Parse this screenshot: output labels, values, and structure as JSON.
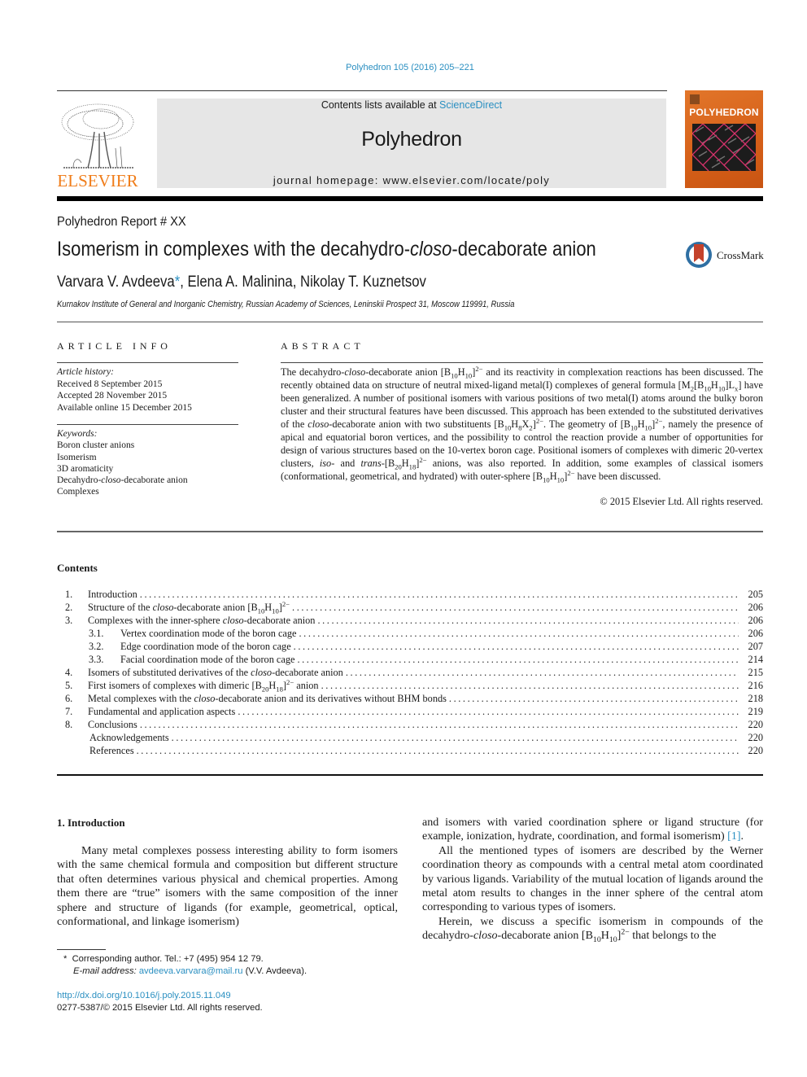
{
  "header": {
    "journal_ref": "Polyhedron 105 (2016) 205–221",
    "contents_prefix": "Contents lists available at ",
    "contents_link": "ScienceDirect",
    "journal_title": "Polyhedron",
    "homepage": "journal homepage: www.elsevier.com/locate/poly",
    "publisher_logo_text": "ELSEVIER",
    "cover_title": "POLYHEDRON",
    "brand_color": "#f07d1a",
    "link_color": "#2a8fc1"
  },
  "article": {
    "report_label": "Polyhedron Report # XX",
    "title_pre": "Isomerism in complexes with the decahydro-",
    "title_italic": "closo",
    "title_post": "-decaborate anion",
    "crossmark_label": "CrossMark",
    "author1": "Varvara V. Avdeeva",
    "author1_mark": "*",
    "authors_rest": ", Elena A. Malinina, Nikolay T. Kuznetsov",
    "affiliation": "Kurnakov Institute of General and Inorganic Chemistry, Russian Academy of Sciences, Leninskii Prospect 31, Moscow 119991, Russia"
  },
  "article_info": {
    "heading": "ARTICLE INFO",
    "history_label": "Article history:",
    "history": [
      "Received 8 September 2015",
      "Accepted 28 November 2015",
      "Available online 15 December 2015"
    ],
    "keywords_label": "Keywords:",
    "keywords": [
      "Boron cluster anions",
      "Isomerism",
      "3D aromaticity",
      "Decahydro-closo-decaborate anion",
      "Complexes"
    ]
  },
  "abstract": {
    "heading": "ABSTRACT",
    "text": "The decahydro-closo-decaborate anion [B10H10]2− and its reactivity in complexation reactions has been discussed. The recently obtained data on structure of neutral mixed-ligand metal(I) complexes of general formula [M2[B10H10]Lx] have been generalized. A number of positional isomers with various positions of two metal(I) atoms around the bulky boron cluster and their structural features have been discussed. This approach has been extended to the substituted derivatives of the closo-decaborate anion with two substituents [B10H8X2]2−. The geometry of [B10H10]2−, namely the presence of apical and equatorial boron vertices, and the possibility to control the reaction provide a number of opportunities for design of various structures based on the 10-vertex boron cage. Positional isomers of complexes with dimeric 20-vertex clusters, iso- and trans-[B20H18]2− anions, was also reported. In addition, some examples of classical isomers (conformational, geometrical, and hydrated) with outer-sphere [B10H10]2− have been discussed.",
    "copyright": "© 2015 Elsevier Ltd. All rights reserved."
  },
  "contents": {
    "heading": "Contents",
    "items": [
      {
        "num": "1.",
        "title": "Introduction",
        "page": "205",
        "level": 1
      },
      {
        "num": "2.",
        "title": "Structure of the closo-decaborate anion [B10H10]2−",
        "page": "206",
        "level": 1
      },
      {
        "num": "3.",
        "title": "Complexes with the inner-sphere closo-decaborate anion",
        "page": "206",
        "level": 1
      },
      {
        "num": "3.1.",
        "title": "Vertex coordination mode of the boron cage",
        "page": "206",
        "level": 2
      },
      {
        "num": "3.2.",
        "title": "Edge coordination mode of the boron cage",
        "page": "207",
        "level": 2
      },
      {
        "num": "3.3.",
        "title": "Facial coordination mode of the boron cage",
        "page": "214",
        "level": 2
      },
      {
        "num": "4.",
        "title": "Isomers of substituted derivatives of the closo-decaborate anion",
        "page": "215",
        "level": 1
      },
      {
        "num": "5.",
        "title": "First isomers of complexes with dimeric [B20H18]2− anion",
        "page": "216",
        "level": 1
      },
      {
        "num": "6.",
        "title": "Metal complexes with the closo-decaborate anion and its derivatives without BHM bonds",
        "page": "218",
        "level": 1
      },
      {
        "num": "7.",
        "title": "Fundamental and application aspects",
        "page": "219",
        "level": 1
      },
      {
        "num": "8.",
        "title": "Conclusions",
        "page": "220",
        "level": 1
      },
      {
        "num": "",
        "title": "Acknowledgements",
        "page": "220",
        "level": 0
      },
      {
        "num": "",
        "title": "References",
        "page": "220",
        "level": 0
      }
    ]
  },
  "body": {
    "section_heading": "1. Introduction",
    "left_para": "Many metal complexes possess interesting ability to form isomers with the same chemical formula and composition but different structure that often determines various physical and chemical properties. Among them there are “true” isomers with the same composition of the inner sphere and structure of ligands (for example, geometrical, optical, conformational, and linkage isomerism)",
    "right_para1": "and isomers with varied coordination sphere or ligand structure (for example, ionization, hydrate, coordination, and formal isomerism) ",
    "right_para1_ref": "[1]",
    "right_para2": "All the mentioned types of isomers are described by the Werner coordination theory as compounds with a central metal atom coordinated by various ligands. Variability of the mutual location of ligands around the metal atom results to changes in the inner sphere of the central atom corresponding to various types of isomers.",
    "right_para3": "Herein, we discuss a specific isomerism in compounds of the decahydro-closo-decaborate anion [B10H10]2− that belongs to the"
  },
  "footnote": {
    "mark": "*",
    "corresponding": "Corresponding author. Tel.: +7 (495) 954 12 79.",
    "email_label": "E-mail address:",
    "email": "avdeeva.varvara@mail.ru",
    "email_suffix": "(V.V. Avdeeva).",
    "doi": "http://dx.doi.org/10.1016/j.poly.2015.11.049",
    "issn_copyright": "0277-5387/© 2015 Elsevier Ltd. All rights reserved."
  }
}
